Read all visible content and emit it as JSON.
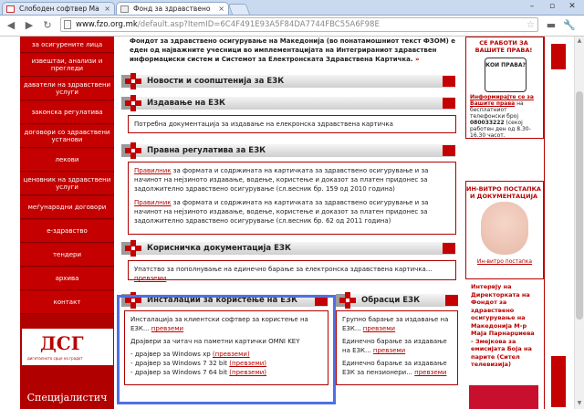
{
  "browser": {
    "tabs": [
      {
        "title": "Слободен софтвер Ма"
      },
      {
        "title": "Фонд за здравствено"
      }
    ],
    "url_host": "www.fzo.org.mk",
    "url_path": "/default.asp?ItemID=6C4F491E93A5F84DA7744FBC55A6F98E"
  },
  "leftnav": {
    "items": [
      "за осигурените лица",
      "извештаи, анализи и прегледи",
      "даватели на здравствени услуги",
      "законска регулатива",
      "договори со здравствени установи",
      "лекови",
      "ценовник на здравствени услуги",
      "меѓународни договори",
      "е-здравство",
      "тендери",
      "архива",
      "контакт"
    ],
    "logo_text": "ДСГ",
    "logo_sub": "дигиталното срце на градот",
    "bottom_box": "Специјалистич"
  },
  "main": {
    "intro": "Фондот за здравствено осигурување на Македонија (во понатамошниот текст ФЗОМ) е еден од најважните учесници во имплементацијата на Интегрираниот здравствен информациски систем и Системот за Електронската Здравствена Картичка.",
    "intro_more": "»",
    "sections": {
      "news": "Новости и соопштенија за ЕЗК",
      "issuing": "Издавање на ЕЗК",
      "issuing_text": "Потребна документација за издавање на елекронска здравствена картичка",
      "legal": "Правна регулатива за ЕЗК",
      "legal_link1": "Правилник",
      "legal_text1": " за формата и содржината на картичката за здравствено осигурување и за начинот на нејзиното издавање, водење, користење и доказот за платен придонес за задолжително здравствено осигурување (сл.весник бр. 159 од 2010 година)",
      "legal_link2": "Правилник",
      "legal_text2": " за формата и содржината на картичката за здравствено осигурување и за начинот на нејзиното издавање, водење, користење и доказот за платен придонес за задолжително здравствено осигурување (сл.весник бр. 62 од 2011 година)",
      "userdoc": "Корисничка документација ЕЗК",
      "userdoc_text": "Упатство за пополнување на единечно барање за електронска здравствена картичка...",
      "userdoc_link": "превземи",
      "install": "Инсталации за користење на ЕЗК",
      "install_line1": "Инсталација за клиентски софтвер за користење на ЕЗК...",
      "install_line1_link": "превземи",
      "install_line2": "Драјвери за читач на паметни картички OMNI KEY",
      "install_d1": "- драјвер за  Windows xp",
      "install_d2": "- драјвер за  Windows 7 32 bit",
      "install_d3": "- драјвер за  Windows 7 64 bit",
      "install_link": "(превземи)",
      "forms": "Обрасци ЕЗК",
      "forms_l1": "Групно барање за издавање на ЕЗК...",
      "forms_l2": "Единечно барање за издавање на ЕЗК...",
      "forms_l3": "Единечно барање за издавање ЕЗК за пензионери...",
      "forms_link": "превземи"
    }
  },
  "right": {
    "top_text": "СЕ РАБОТИ ЗА ВАШИТЕ ПРАВА!",
    "inform_link": "Информирајте се за Вашите права",
    "inform_text1": " на бесплатниот телефонски број ",
    "phone": "080033222",
    "inform_text2": " (секој работен ден од 8.30-16.30 часот.",
    "invitro_title": "ИН-ВИТРО ПОСТАПКА И ДОКУМЕНТАЦИЈА",
    "invitro_caption": "Ин-витро постапка",
    "interview": "Интервју на Директорката на Фондот за здравствено осигурување на Македонија М-р Маја Парнарџиева - Змејкова за емисијата Боја на парите (Сител телевизија)",
    "badge_text": "КОИ ПРАВА?"
  }
}
